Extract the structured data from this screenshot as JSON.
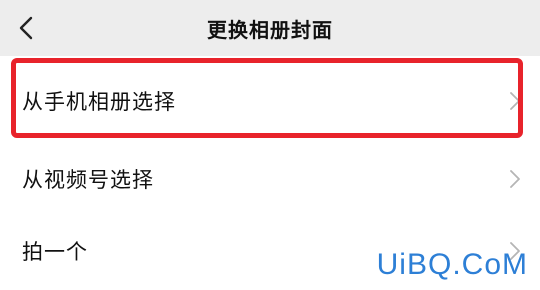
{
  "header": {
    "back_icon": "chevron-left-icon",
    "title": "更换相册封面"
  },
  "menu": {
    "items": [
      {
        "label": "从手机相册选择",
        "icon": "chevron-right-icon"
      },
      {
        "label": "从视频号选择",
        "icon": "chevron-right-icon"
      },
      {
        "label": "拍一个",
        "icon": "chevron-right-icon"
      }
    ]
  },
  "annotation": {
    "highlight_color": "#e8232b"
  },
  "watermark": {
    "text": "UiBQ.CoM",
    "color": "#2d7fd6"
  }
}
